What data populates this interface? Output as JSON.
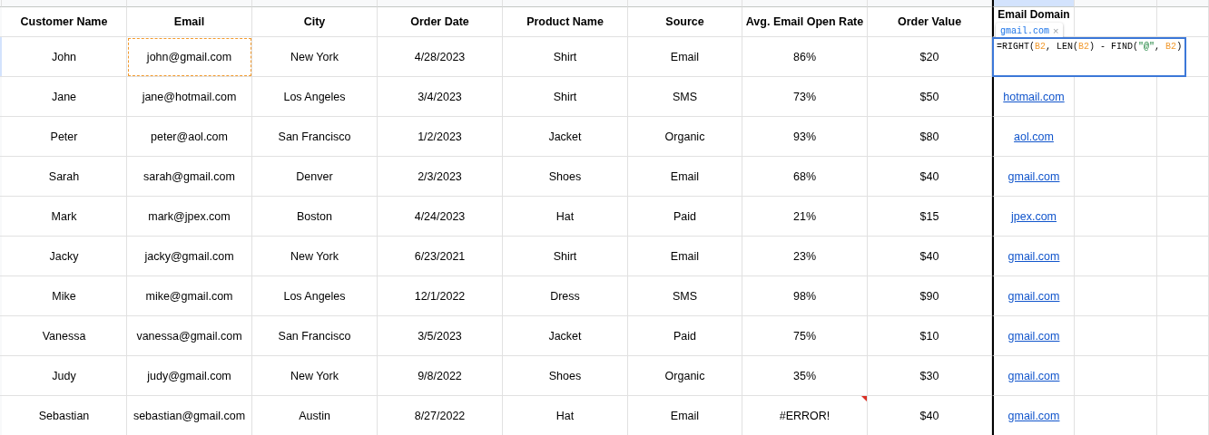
{
  "columns": [
    {
      "label": "Customer Name",
      "selected": false
    },
    {
      "label": "Email",
      "selected": false
    },
    {
      "label": "City",
      "selected": false
    },
    {
      "label": "Order Date",
      "selected": false
    },
    {
      "label": "Product Name",
      "selected": false
    },
    {
      "label": "Source",
      "selected": false
    },
    {
      "label": "Avg. Email Open Rate",
      "selected": false
    },
    {
      "label": "Order Value",
      "selected": false
    },
    {
      "label": "Email Domain",
      "selected": true
    }
  ],
  "rows": [
    {
      "selected": true,
      "copied": true,
      "error": false,
      "cells": [
        "John",
        "john@gmail.com",
        "New York",
        "4/28/2023",
        "Shirt",
        "Email",
        "86%",
        "$20"
      ]
    },
    {
      "selected": false,
      "copied": false,
      "error": false,
      "cells": [
        "Jane",
        "jane@hotmail.com",
        "Los Angeles",
        "3/4/2023",
        "Shirt",
        "SMS",
        "73%",
        "$50"
      ],
      "domain": "hotmail.com"
    },
    {
      "selected": false,
      "copied": false,
      "error": false,
      "cells": [
        "Peter",
        "peter@aol.com",
        "San Francisco",
        "1/2/2023",
        "Jacket",
        "Organic",
        "93%",
        "$80"
      ],
      "domain": "aol.com"
    },
    {
      "selected": false,
      "copied": false,
      "error": false,
      "cells": [
        "Sarah",
        "sarah@gmail.com",
        "Denver",
        "2/3/2023",
        "Shoes",
        "Email",
        "68%",
        "$40"
      ],
      "domain": "gmail.com"
    },
    {
      "selected": false,
      "copied": false,
      "error": false,
      "cells": [
        "Mark",
        "mark@jpex.com",
        "Boston",
        "4/24/2023",
        "Hat",
        "Paid",
        "21%",
        "$15"
      ],
      "domain": "jpex.com"
    },
    {
      "selected": false,
      "copied": false,
      "error": false,
      "cells": [
        "Jacky",
        "jacky@gmail.com",
        "New York",
        "6/23/2021",
        "Shirt",
        "Email",
        "23%",
        "$40"
      ],
      "domain": "gmail.com"
    },
    {
      "selected": false,
      "copied": false,
      "error": false,
      "cells": [
        "Mike",
        "mike@gmail.com",
        "Los Angeles",
        "12/1/2022",
        "Dress",
        "SMS",
        "98%",
        "$90"
      ],
      "domain": "gmail.com"
    },
    {
      "selected": false,
      "copied": false,
      "error": false,
      "cells": [
        "Vanessa",
        "vanessa@gmail.com",
        "San Francisco",
        "3/5/2023",
        "Jacket",
        "Paid",
        "75%",
        "$10"
      ],
      "domain": "gmail.com"
    },
    {
      "selected": false,
      "copied": false,
      "error": false,
      "cells": [
        "Judy",
        "judy@gmail.com",
        "New York",
        "9/8/2022",
        "Shoes",
        "Organic",
        "35%",
        "$30"
      ],
      "domain": "gmail.com"
    },
    {
      "selected": false,
      "copied": false,
      "error": true,
      "cells": [
        "Sebastian",
        "sebastian@gmail.com",
        "Austin",
        "8/27/2022",
        "Hat",
        "Email",
        "#ERROR!",
        "$40"
      ],
      "domain": "gmail.com"
    }
  ],
  "formula_editor": {
    "preview": "gmail.com",
    "close": "×",
    "parts": [
      {
        "kind": "text",
        "text": "=RIGHT("
      },
      {
        "kind": "ref",
        "text": "B2"
      },
      {
        "kind": "text",
        "text": ", LEN("
      },
      {
        "kind": "ref",
        "text": "B2"
      },
      {
        "kind": "text",
        "text": ") - FIND("
      },
      {
        "kind": "string",
        "text": "\"@\""
      },
      {
        "kind": "text",
        "text": ", "
      },
      {
        "kind": "ref",
        "text": "B2"
      },
      {
        "kind": "text",
        "text": ")"
      }
    ]
  }
}
